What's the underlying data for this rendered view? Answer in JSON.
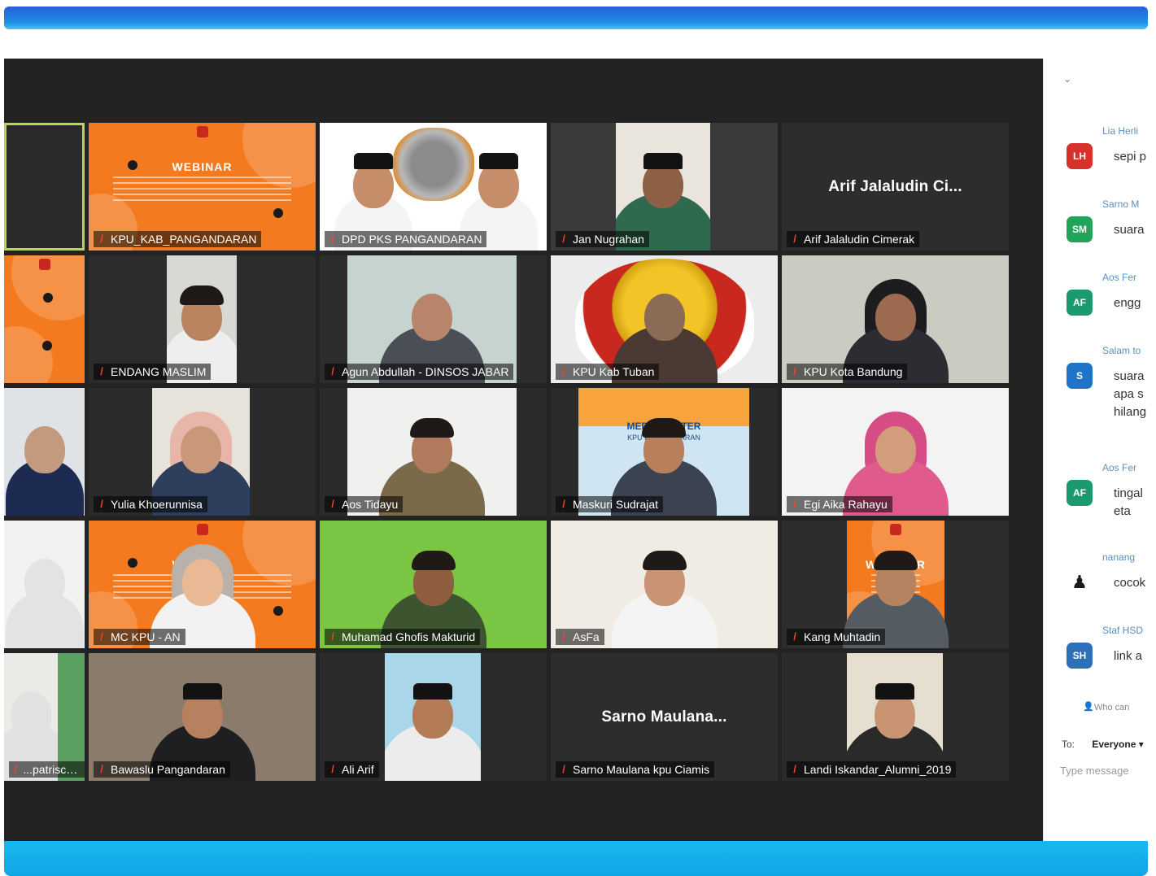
{
  "tiles": [
    {
      "name": ""
    },
    {
      "name": "KPU_KAB_PANGANDARAN"
    },
    {
      "name": "DPD PKS PANGANDARAN"
    },
    {
      "name": "Jan Nugrahan"
    },
    {
      "name": "Arif Jalaludin  Cimerak",
      "center": "Arif Jalaludin  Ci..."
    },
    {
      "name": ""
    },
    {
      "name": "ENDANG MASLIM"
    },
    {
      "name": "Agun Abdullah - DINSOS JABAR"
    },
    {
      "name": "KPU Kab Tuban"
    },
    {
      "name": "KPU Kota Bandung"
    },
    {
      "name": ""
    },
    {
      "name": "Yulia Khoerunnisa"
    },
    {
      "name": "Aos Tidayu"
    },
    {
      "name": "Maskuri Sudrajat"
    },
    {
      "name": "Egi Aika Rahayu"
    },
    {
      "name": ""
    },
    {
      "name": "MC KPU - AN"
    },
    {
      "name": "Muhamad Ghofis Makturid"
    },
    {
      "name": "AsFa"
    },
    {
      "name": "Kang Muhtadin"
    },
    {
      "name": "...patriscorpan..."
    },
    {
      "name": "Bawaslu Pangandaran"
    },
    {
      "name": "Ali Arif"
    },
    {
      "name": "Sarno Maulana kpu Ciamis",
      "center": "Sarno  Maulana..."
    },
    {
      "name": "Landi Iskandar_Alumni_2019"
    }
  ],
  "webinar": {
    "title": "WEBINAR"
  },
  "media_center": {
    "line1": "MEDIA CENTER",
    "line2": "KPU PANGANDARAN"
  },
  "chat": {
    "messages": [
      {
        "sender": "Lia Herli",
        "initials": "LH",
        "color": "#d6322b",
        "text": "sepi p"
      },
      {
        "sender": "Sarno M",
        "initials": "SM",
        "color": "#22a35a",
        "text": "suara"
      },
      {
        "sender": "Aos Fer",
        "initials": "AF",
        "color": "#1a9a6e",
        "text": "engg"
      },
      {
        "sender": "Salam to",
        "initials": "S",
        "color": "#1e74c9",
        "text": "suara\napa s\nhilang"
      },
      {
        "sender": "Aos Fer",
        "initials": "AF",
        "color": "#1a9a6e",
        "text": "tingal\neta"
      },
      {
        "sender": "nanang",
        "initials": "",
        "color": "#ffffff",
        "text": "cocok"
      },
      {
        "sender": "Staf HSD",
        "initials": "SH",
        "color": "#2d6fb8",
        "text": "link a"
      }
    ],
    "who_can_see": "Who can",
    "to_label": "To:",
    "to_value": "Everyone",
    "placeholder": "Type message"
  }
}
